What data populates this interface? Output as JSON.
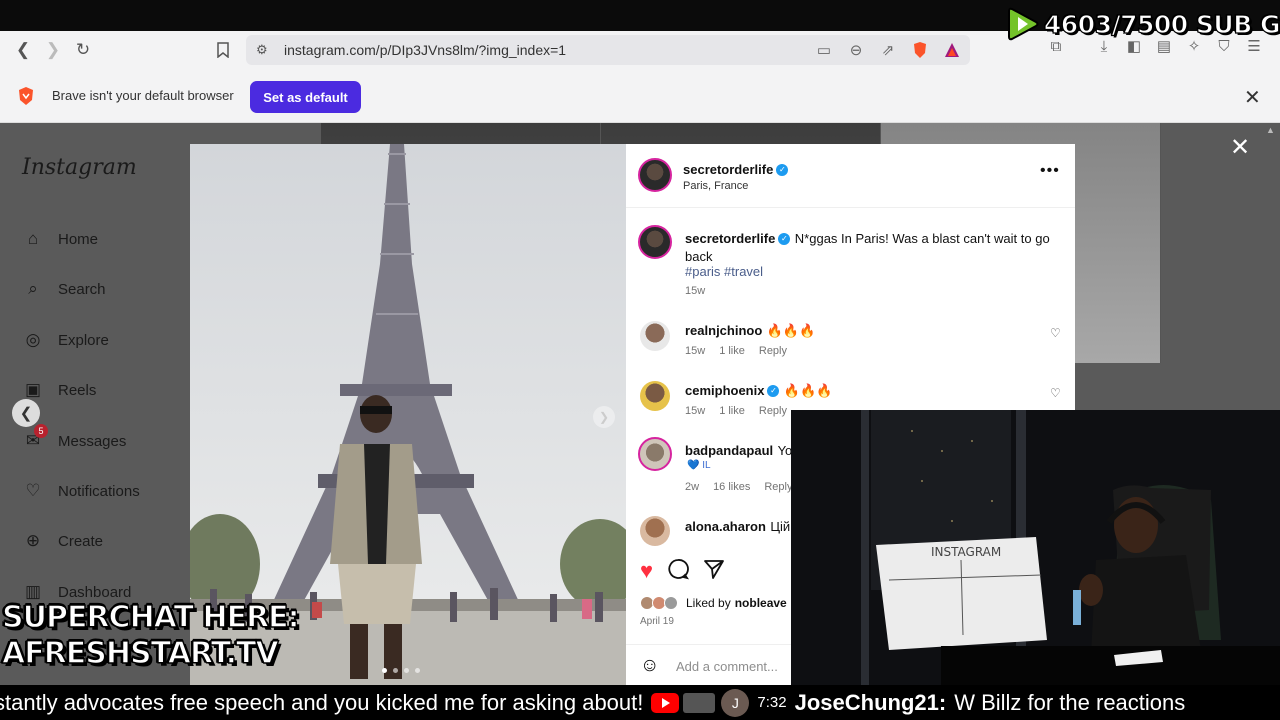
{
  "stream": {
    "sub_goal": "4603/7500 SUB G",
    "superchat_line1": "SUPERCHAT HERE:",
    "superchat_line2": "AFRESHSTART.TV",
    "ticker_text": "stantly advocates free speech and you kicked me for asking about!",
    "ticker_avatar": "J",
    "ticker_time": "7:32",
    "ticker_user": "JoseChung21:",
    "ticker_message": "W Billz for the reactions"
  },
  "browser": {
    "url": "instagram.com/p/DIp3JVns8lm/?img_index=1",
    "infobar_message": "Brave isn't your default browser",
    "set_default_label": "Set as default",
    "accent": "#4b2be0"
  },
  "instagram": {
    "logo": "Instagram",
    "nav": [
      {
        "label": "Home",
        "icon": "home-icon",
        "glyph": "⌂"
      },
      {
        "label": "Search",
        "icon": "search-icon",
        "glyph": "⌕"
      },
      {
        "label": "Explore",
        "icon": "compass-icon",
        "glyph": "◎"
      },
      {
        "label": "Reels",
        "icon": "reels-icon",
        "glyph": "▣"
      },
      {
        "label": "Messages",
        "icon": "messenger-icon",
        "glyph": "✉",
        "badge": "5"
      },
      {
        "label": "Notifications",
        "icon": "heart-icon",
        "glyph": "♡"
      },
      {
        "label": "Create",
        "icon": "plus-icon",
        "glyph": "⊕"
      },
      {
        "label": "Dashboard",
        "icon": "dashboard-icon",
        "glyph": "▥"
      }
    ]
  },
  "post": {
    "author": "secretorderlife",
    "location": "Paris, France",
    "caption": "N*ggas In Paris! Was a blast can't wait to go back",
    "hashtags": "#paris #travel",
    "caption_age": "15w",
    "comments": [
      {
        "user": "realnjchinoo",
        "text": "🔥🔥🔥",
        "age": "15w",
        "likes": "1 like",
        "reply": "Reply"
      },
      {
        "user": "cemiphoenix",
        "verified": true,
        "text": "🔥🔥🔥",
        "age": "15w",
        "likes": "1 like",
        "reply": "Reply"
      },
      {
        "user": "badpandapaul",
        "text": "You",
        "text2": "💙 IL",
        "age": "2w",
        "likes": "16 likes",
        "reply": "Reply"
      },
      {
        "user": "alona.aharon",
        "text": "Цій"
      }
    ],
    "liked_by_prefix": "Liked by",
    "liked_by_user": "nobleave",
    "date": "April 19",
    "add_comment_placeholder": "Add a comment..."
  }
}
